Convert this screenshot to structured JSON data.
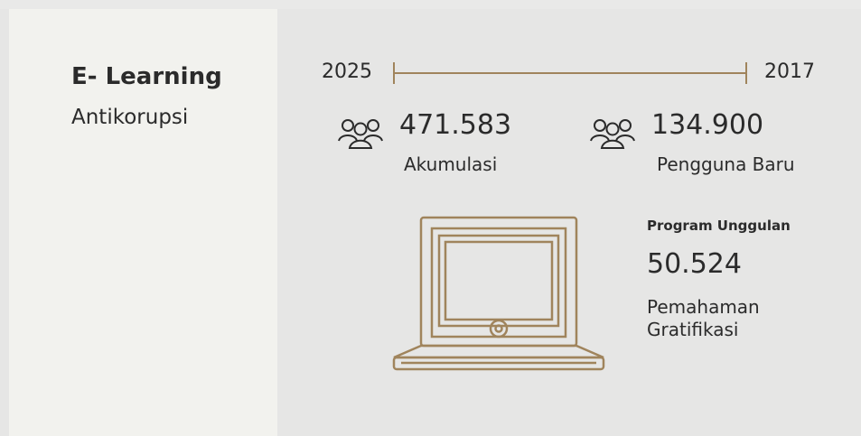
{
  "sidebar": {
    "title": "E- Learning",
    "subtitle": "Antikorupsi"
  },
  "timeline": {
    "start_year": "2025",
    "end_year": "2017"
  },
  "stats": [
    {
      "value": "471.583",
      "label": "Akumulasi",
      "icon": "users-group-icon"
    },
    {
      "value": "134.900",
      "label": "Pengguna Baru",
      "icon": "users-group-icon"
    }
  ],
  "program": {
    "heading": "Program Unggulan",
    "value": "50.524",
    "description": "Pemahaman Gratifikasi",
    "icon": "laptop-icon"
  },
  "colors": {
    "accent": "#a0845c",
    "text": "#2b2b2b",
    "left_panel": "#f2f2ee",
    "main_bg": "#e6e6e5"
  }
}
